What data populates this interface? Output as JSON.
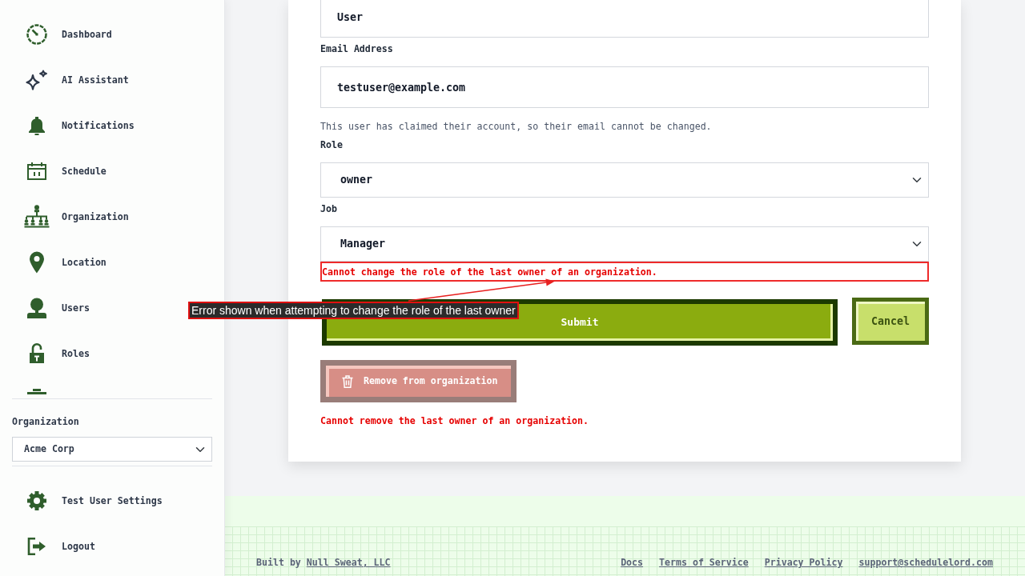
{
  "sidebar": {
    "nav_items": [
      {
        "kind": "link",
        "label": "Dashboard"
      },
      {
        "kind": "link",
        "label": "AI Assistant"
      },
      {
        "kind": "link",
        "label": "Notifications"
      },
      {
        "kind": "link",
        "label": "Schedule"
      },
      {
        "kind": "link",
        "label": "Organization"
      },
      {
        "kind": "link",
        "label": "Location"
      },
      {
        "kind": "link",
        "label": "Users"
      },
      {
        "kind": "link",
        "label": "Roles"
      },
      {
        "kind": "clipped"
      }
    ],
    "organization": {
      "label": "Organization",
      "value": "Acme Corp"
    },
    "account_items": [
      {
        "kind": "link",
        "label": "Test User Settings"
      },
      {
        "kind": "link",
        "label": "Logout"
      }
    ]
  },
  "form": {
    "fields": [
      {
        "kind": "input",
        "value": "User"
      },
      {
        "kind": "input",
        "label": "Email Address",
        "value": "testuser@example.com",
        "help": "This user has claimed their account, so their email cannot be changed."
      },
      {
        "kind": "select",
        "label": "Role",
        "value": "owner"
      },
      {
        "kind": "select",
        "label": "Job",
        "value": "Manager",
        "error": {
          "text": "Cannot change the role of the last owner of an organization.",
          "highlighted": true
        }
      }
    ],
    "submit": "Submit",
    "cancel": "Cancel",
    "remove": {
      "label": "Remove from organization",
      "disabled": true,
      "error": {
        "text": "Cannot remove the last owner of an organization.",
        "highlighted": false
      }
    }
  },
  "annotation": {
    "text": "Error shown when attempting to change the role of the last owner"
  },
  "footer": {
    "credit": "Built by",
    "credit_link": "Null Sweat, LLC",
    "links": [
      "Docs",
      "Terms of Service",
      "Privacy Policy",
      "support@schedulelord.com"
    ]
  }
}
